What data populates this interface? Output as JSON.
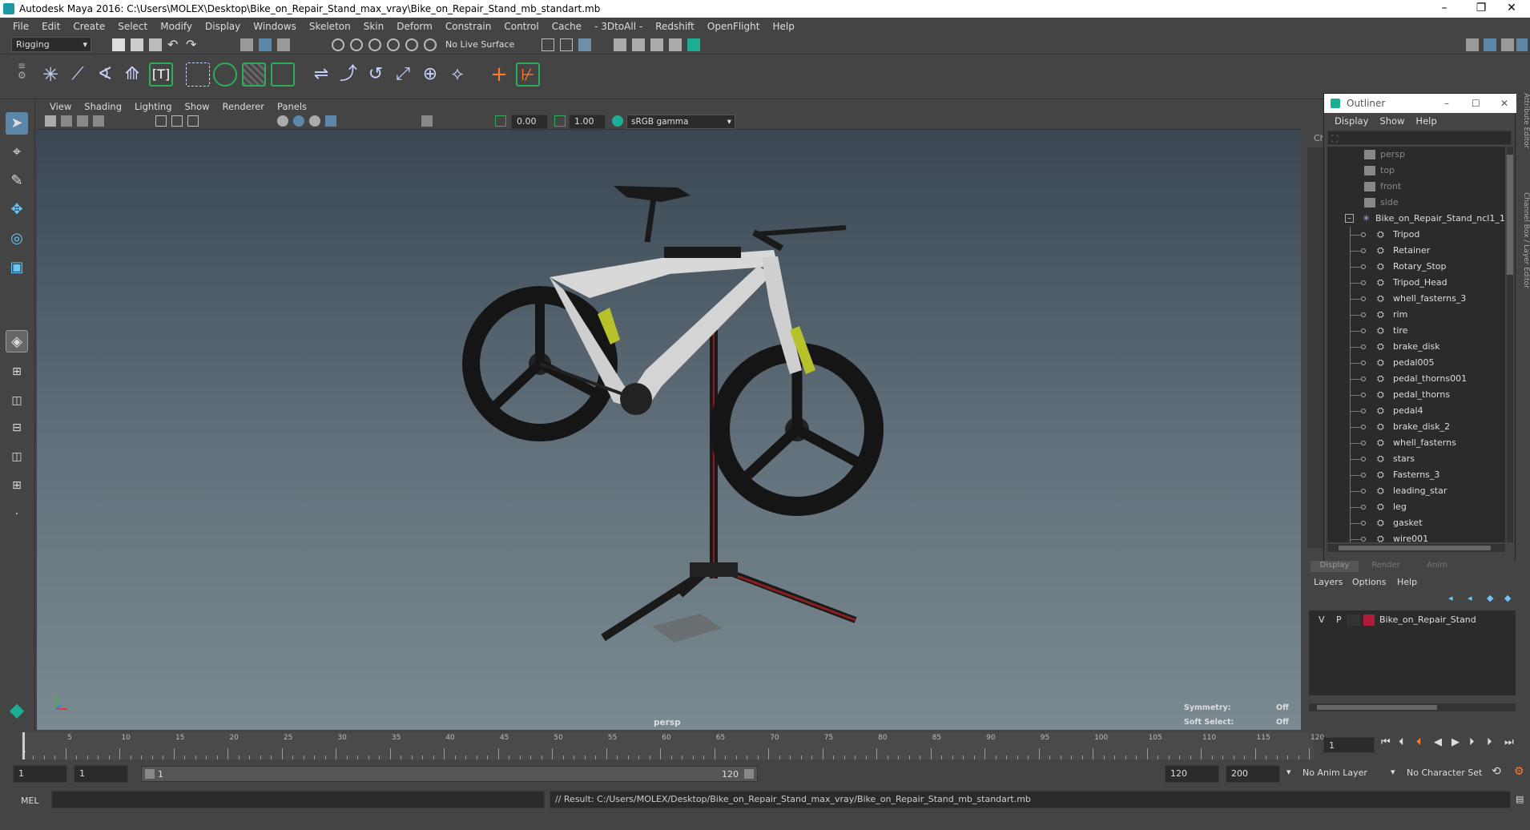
{
  "titlebar": {
    "title": "Autodesk Maya 2016: C:\\Users\\MOLEX\\Desktop\\Bike_on_Repair_Stand_max_vray\\Bike_on_Repair_Stand_mb_standart.mb"
  },
  "menubar": [
    "File",
    "Edit",
    "Create",
    "Select",
    "Modify",
    "Display",
    "Windows",
    "Skeleton",
    "Skin",
    "Deform",
    "Constrain",
    "Control",
    "Cache",
    "- 3DtoAll -",
    "Redshift",
    "OpenFlight",
    "Help"
  ],
  "status": {
    "mode": "Rigging",
    "live_surface": "No Live Surface"
  },
  "viewport": {
    "menu": [
      "View",
      "Shading",
      "Lighting",
      "Show",
      "Renderer",
      "Panels"
    ],
    "exposure": "0.00",
    "gamma": "1.00",
    "colorspace": "sRGB gamma",
    "camera_label": "persp",
    "hud": [
      {
        "label": "Symmetry:",
        "value": "Off"
      },
      {
        "label": "Soft Select:",
        "value": "Off"
      }
    ]
  },
  "channel_tab": "Ch",
  "side_tabs": {
    "top": "Attribute Editor",
    "bottom": "Channel Box / Layer Editor"
  },
  "outliner": {
    "title": "Outliner",
    "menu": [
      "Display",
      "Show",
      "Help"
    ],
    "cameras": [
      "persp",
      "top",
      "front",
      "side"
    ],
    "root": "Bike_on_Repair_Stand_ncl1_1",
    "items": [
      "Tripod",
      "Retainer",
      "Rotary_Stop",
      "Tripod_Head",
      "whell_fasterns_3",
      "rim",
      "tire",
      "brake_disk",
      "pedal005",
      "pedal_thorns001",
      "pedal_thorns",
      "pedal4",
      "brake_disk_2",
      "whell_fasterns",
      "stars",
      "Fasterns_3",
      "leading_star",
      "leg",
      "gasket",
      "wire001"
    ]
  },
  "layer_editor": {
    "tabs": [
      "Display",
      "Render",
      "Anim"
    ],
    "menu": [
      "Layers",
      "Options",
      "Help"
    ],
    "layer": {
      "v": "V",
      "p": "P",
      "name": "Bike_on_Repair_Stand",
      "color": "#b01c38"
    }
  },
  "timeline": {
    "ticks": [
      "5",
      "10",
      "15",
      "20",
      "25",
      "30",
      "35",
      "40",
      "45",
      "50",
      "55",
      "60",
      "65",
      "70",
      "75",
      "80",
      "85",
      "90",
      "95",
      "100",
      "105",
      "110",
      "115",
      "120"
    ],
    "start_label": "1",
    "end_label": "120",
    "current_frame": "1"
  },
  "range": {
    "start": "1",
    "playback_start": "1",
    "slider_start": "1",
    "slider_end": "120",
    "playback_end": "120",
    "end": "200",
    "anim_layer": "No Anim Layer",
    "char_set": "No Character Set"
  },
  "cmdline": {
    "lang": "MEL",
    "result": "// Result: C:/Users/MOLEX/Desktop/Bike_on_Repair_Stand_max_vray/Bike_on_Repair_Stand_mb_standart.mb"
  }
}
